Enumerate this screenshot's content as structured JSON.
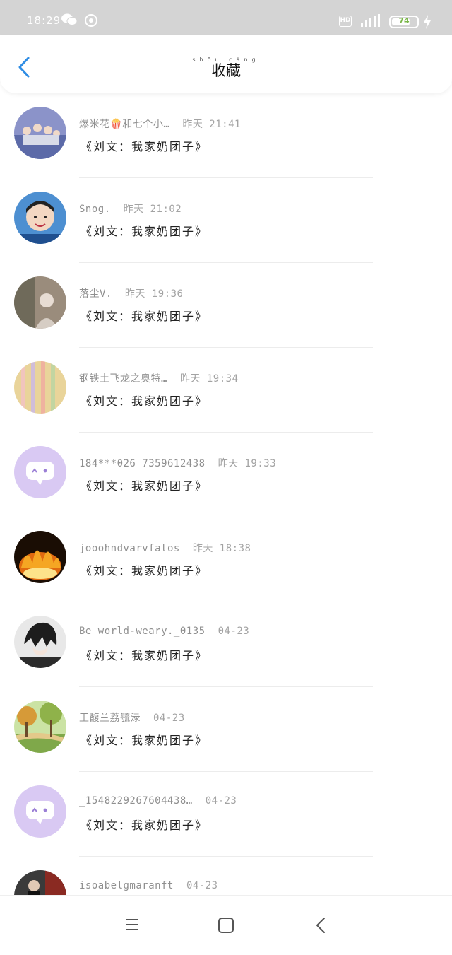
{
  "status_bar": {
    "time": "18:29",
    "hd_label": "HD",
    "battery": "74"
  },
  "header": {
    "title": "收藏",
    "title_pinyin": "shōu cáng"
  },
  "list": [
    {
      "user": "爆米花🍿和七个小…",
      "time": "昨天 21:41",
      "content": "《刘文：我家奶团子》",
      "avatar": "group-photo"
    },
    {
      "user": "Snog.",
      "time": "昨天 21:02",
      "content": "《刘文：我家奶团子》",
      "avatar": "child-photo"
    },
    {
      "user": "落尘V.",
      "time": "昨天 19:36",
      "content": "《刘文：我家奶团子》",
      "avatar": "portrait-photo"
    },
    {
      "user": "钢铁土飞龙之奥特…",
      "time": "昨天 19:34",
      "content": "《刘文：我家奶团子》",
      "avatar": "light-photo"
    },
    {
      "user": "184***026_7359612438",
      "time": "昨天 19:33",
      "content": "《刘文：我家奶团子》",
      "avatar": "default"
    },
    {
      "user": "jooohndvarvfatos",
      "time": "昨天 18:38",
      "content": "《刘文：我家奶团子》",
      "avatar": "fire-photo"
    },
    {
      "user": "Be world-weary._0135",
      "time": "04-23",
      "content": "《刘文：我家奶团子》",
      "avatar": "anime-photo"
    },
    {
      "user": "王馥兰荔毓渌",
      "time": "04-23",
      "content": "《刘文：我家奶团子》",
      "avatar": "park-photo"
    },
    {
      "user": "_1548229267604438…",
      "time": "04-23",
      "content": "《刘文：我家奶团子》",
      "avatar": "default"
    },
    {
      "user": "isoabelgmaranft",
      "time": "04-23",
      "content": "",
      "avatar": "street-photo"
    }
  ],
  "icons": {
    "back": "chevron-left-icon",
    "nav_menu": "menu-icon",
    "nav_home": "square-icon",
    "nav_back": "triangle-back-icon"
  },
  "colors": {
    "accent": "#2f8de4",
    "default_avatar_bg": "#d9c9f3",
    "default_avatar_fg": "#9b7fd6"
  }
}
